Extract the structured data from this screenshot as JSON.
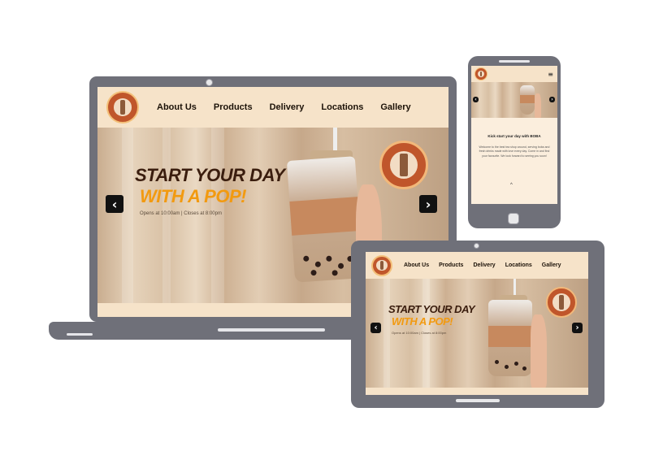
{
  "nav": [
    "About Us",
    "Products",
    "Delivery",
    "Locations",
    "Gallery"
  ],
  "hero": {
    "line1": "START YOUR DAY",
    "line2": "WITH A POP!",
    "hours": "Opens at 10:00am | Closes at 8:00pm",
    "prev_icon": "‹",
    "next_icon": "›"
  },
  "mobile": {
    "heading": "Kick start your day with BOBA",
    "body": "Welcome to the best tea shop around, serving boba and fresh drinks made with love every day. Come in and find your favourite. We look forward to seeing you soon!",
    "arrow_up_icon": "^",
    "menu_icon": "hamburger-icon"
  },
  "colors": {
    "header_bg": "#f6e3c9",
    "frame": "#6f7079",
    "title_dark": "#3a1d0e",
    "title_accent": "#f29a10",
    "logo": "#c0562b"
  }
}
